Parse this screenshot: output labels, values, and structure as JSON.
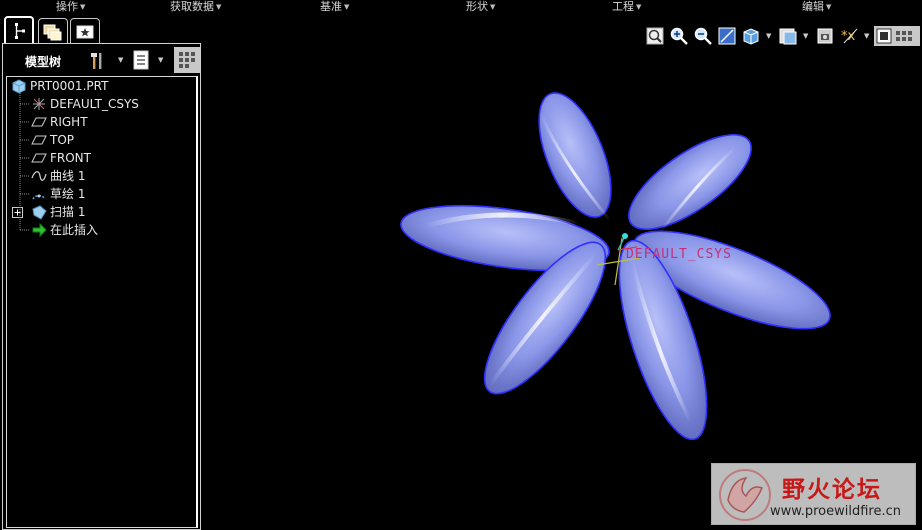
{
  "menu": {
    "items": [
      {
        "label": "操作"
      },
      {
        "label": "获取数据"
      },
      {
        "label": "基准"
      },
      {
        "label": "形状"
      },
      {
        "label": "工程"
      },
      {
        "label": "编辑"
      }
    ]
  },
  "navigator": {
    "tabs": [
      {
        "icon": "model-tree-icon",
        "active": true
      },
      {
        "icon": "folder-browser-icon",
        "active": false
      },
      {
        "icon": "favorites-icon",
        "active": false
      }
    ],
    "title": "模型树",
    "toolbar_icons": [
      "settings-hammer-icon",
      "show-list-icon",
      "filter-grid-icon"
    ]
  },
  "model_tree": {
    "items": [
      {
        "label": "PRT0001.PRT",
        "icon": "part-icon",
        "indent": 0,
        "expandable": false
      },
      {
        "label": "DEFAULT_CSYS",
        "icon": "csys-icon",
        "indent": 1,
        "expandable": false
      },
      {
        "label": "RIGHT",
        "icon": "datum-plane-icon",
        "indent": 1,
        "expandable": false
      },
      {
        "label": "TOP",
        "icon": "datum-plane-icon",
        "indent": 1,
        "expandable": false
      },
      {
        "label": "FRONT",
        "icon": "datum-plane-icon",
        "indent": 1,
        "expandable": false
      },
      {
        "label": "曲线 1",
        "icon": "curve-icon",
        "indent": 1,
        "expandable": false
      },
      {
        "label": "草绘 1",
        "icon": "sketch-icon",
        "indent": 1,
        "expandable": false
      },
      {
        "label": "扫描 1",
        "icon": "sweep-icon",
        "indent": 1,
        "expandable": true
      },
      {
        "label": "在此插入",
        "icon": "insert-here-arrow-icon",
        "indent": 1,
        "expandable": false
      }
    ]
  },
  "view_toolbar": {
    "icons": [
      "refit-icon",
      "zoom-in-icon",
      "zoom-out-icon",
      "repaint-icon",
      "display-style-icon",
      "saved-views-icon",
      "layers-icon",
      "datum-display-icon",
      "appearance-icon"
    ]
  },
  "viewport": {
    "csys_label": "DEFAULT_CSYS",
    "model_color": "#8a96e8",
    "edge_color": "#3a3aff"
  },
  "watermark": {
    "title": "野火论坛",
    "url": "www.proewildfire.cn"
  }
}
